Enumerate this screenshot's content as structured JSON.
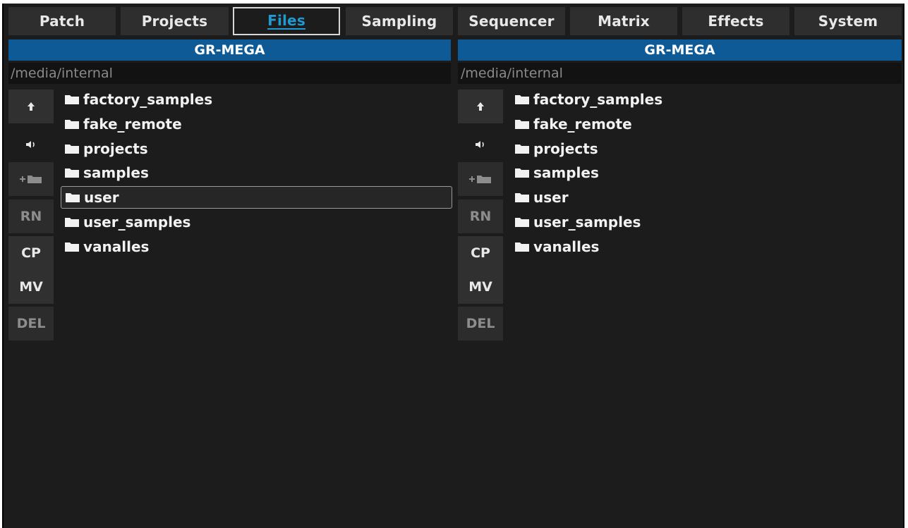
{
  "tabs": [
    {
      "label": "Patch",
      "active": false
    },
    {
      "label": "Projects",
      "active": false
    },
    {
      "label": "Files",
      "active": true
    },
    {
      "label": "Sampling",
      "active": false
    },
    {
      "label": "Sequencer",
      "active": false
    },
    {
      "label": "Matrix",
      "active": false
    },
    {
      "label": "Effects",
      "active": false
    },
    {
      "label": "System",
      "active": false
    }
  ],
  "colors": {
    "accent": "#1f9bd1",
    "header_bg": "#0d5a96",
    "background": "#1c1c1c"
  },
  "left_panel": {
    "title": "GR-MEGA",
    "path": "/media/internal",
    "buttons": {
      "up_icon": "arrow-up-icon",
      "audio_icon": "speaker-icon",
      "new_folder_icon": "new-folder-icon",
      "rename": "RN",
      "copy": "CP",
      "move": "MV",
      "delete": "DEL"
    },
    "items": [
      "factory_samples",
      "fake_remote",
      "projects",
      "samples",
      "user",
      "user_samples",
      "vanalles"
    ],
    "selected": "user"
  },
  "right_panel": {
    "title": "GR-MEGA",
    "path": "/media/internal",
    "buttons": {
      "up_icon": "arrow-up-icon",
      "audio_icon": "speaker-icon",
      "new_folder_icon": "new-folder-icon",
      "rename": "RN",
      "copy": "CP",
      "move": "MV",
      "delete": "DEL"
    },
    "items": [
      "factory_samples",
      "fake_remote",
      "projects",
      "samples",
      "user",
      "user_samples",
      "vanalles"
    ],
    "selected": ""
  }
}
